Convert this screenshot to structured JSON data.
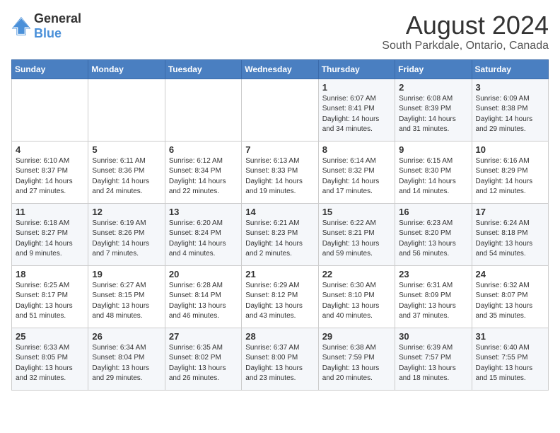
{
  "header": {
    "logo_general": "General",
    "logo_blue": "Blue",
    "month_year": "August 2024",
    "location": "South Parkdale, Ontario, Canada"
  },
  "days_of_week": [
    "Sunday",
    "Monday",
    "Tuesday",
    "Wednesday",
    "Thursday",
    "Friday",
    "Saturday"
  ],
  "weeks": [
    [
      {
        "day": "",
        "text": ""
      },
      {
        "day": "",
        "text": ""
      },
      {
        "day": "",
        "text": ""
      },
      {
        "day": "",
        "text": ""
      },
      {
        "day": "1",
        "text": "Sunrise: 6:07 AM\nSunset: 8:41 PM\nDaylight: 14 hours\nand 34 minutes."
      },
      {
        "day": "2",
        "text": "Sunrise: 6:08 AM\nSunset: 8:39 PM\nDaylight: 14 hours\nand 31 minutes."
      },
      {
        "day": "3",
        "text": "Sunrise: 6:09 AM\nSunset: 8:38 PM\nDaylight: 14 hours\nand 29 minutes."
      }
    ],
    [
      {
        "day": "4",
        "text": "Sunrise: 6:10 AM\nSunset: 8:37 PM\nDaylight: 14 hours\nand 27 minutes."
      },
      {
        "day": "5",
        "text": "Sunrise: 6:11 AM\nSunset: 8:36 PM\nDaylight: 14 hours\nand 24 minutes."
      },
      {
        "day": "6",
        "text": "Sunrise: 6:12 AM\nSunset: 8:34 PM\nDaylight: 14 hours\nand 22 minutes."
      },
      {
        "day": "7",
        "text": "Sunrise: 6:13 AM\nSunset: 8:33 PM\nDaylight: 14 hours\nand 19 minutes."
      },
      {
        "day": "8",
        "text": "Sunrise: 6:14 AM\nSunset: 8:32 PM\nDaylight: 14 hours\nand 17 minutes."
      },
      {
        "day": "9",
        "text": "Sunrise: 6:15 AM\nSunset: 8:30 PM\nDaylight: 14 hours\nand 14 minutes."
      },
      {
        "day": "10",
        "text": "Sunrise: 6:16 AM\nSunset: 8:29 PM\nDaylight: 14 hours\nand 12 minutes."
      }
    ],
    [
      {
        "day": "11",
        "text": "Sunrise: 6:18 AM\nSunset: 8:27 PM\nDaylight: 14 hours\nand 9 minutes."
      },
      {
        "day": "12",
        "text": "Sunrise: 6:19 AM\nSunset: 8:26 PM\nDaylight: 14 hours\nand 7 minutes."
      },
      {
        "day": "13",
        "text": "Sunrise: 6:20 AM\nSunset: 8:24 PM\nDaylight: 14 hours\nand 4 minutes."
      },
      {
        "day": "14",
        "text": "Sunrise: 6:21 AM\nSunset: 8:23 PM\nDaylight: 14 hours\nand 2 minutes."
      },
      {
        "day": "15",
        "text": "Sunrise: 6:22 AM\nSunset: 8:21 PM\nDaylight: 13 hours\nand 59 minutes."
      },
      {
        "day": "16",
        "text": "Sunrise: 6:23 AM\nSunset: 8:20 PM\nDaylight: 13 hours\nand 56 minutes."
      },
      {
        "day": "17",
        "text": "Sunrise: 6:24 AM\nSunset: 8:18 PM\nDaylight: 13 hours\nand 54 minutes."
      }
    ],
    [
      {
        "day": "18",
        "text": "Sunrise: 6:25 AM\nSunset: 8:17 PM\nDaylight: 13 hours\nand 51 minutes."
      },
      {
        "day": "19",
        "text": "Sunrise: 6:27 AM\nSunset: 8:15 PM\nDaylight: 13 hours\nand 48 minutes."
      },
      {
        "day": "20",
        "text": "Sunrise: 6:28 AM\nSunset: 8:14 PM\nDaylight: 13 hours\nand 46 minutes."
      },
      {
        "day": "21",
        "text": "Sunrise: 6:29 AM\nSunset: 8:12 PM\nDaylight: 13 hours\nand 43 minutes."
      },
      {
        "day": "22",
        "text": "Sunrise: 6:30 AM\nSunset: 8:10 PM\nDaylight: 13 hours\nand 40 minutes."
      },
      {
        "day": "23",
        "text": "Sunrise: 6:31 AM\nSunset: 8:09 PM\nDaylight: 13 hours\nand 37 minutes."
      },
      {
        "day": "24",
        "text": "Sunrise: 6:32 AM\nSunset: 8:07 PM\nDaylight: 13 hours\nand 35 minutes."
      }
    ],
    [
      {
        "day": "25",
        "text": "Sunrise: 6:33 AM\nSunset: 8:05 PM\nDaylight: 13 hours\nand 32 minutes."
      },
      {
        "day": "26",
        "text": "Sunrise: 6:34 AM\nSunset: 8:04 PM\nDaylight: 13 hours\nand 29 minutes."
      },
      {
        "day": "27",
        "text": "Sunrise: 6:35 AM\nSunset: 8:02 PM\nDaylight: 13 hours\nand 26 minutes."
      },
      {
        "day": "28",
        "text": "Sunrise: 6:37 AM\nSunset: 8:00 PM\nDaylight: 13 hours\nand 23 minutes."
      },
      {
        "day": "29",
        "text": "Sunrise: 6:38 AM\nSunset: 7:59 PM\nDaylight: 13 hours\nand 20 minutes."
      },
      {
        "day": "30",
        "text": "Sunrise: 6:39 AM\nSunset: 7:57 PM\nDaylight: 13 hours\nand 18 minutes."
      },
      {
        "day": "31",
        "text": "Sunrise: 6:40 AM\nSunset: 7:55 PM\nDaylight: 13 hours\nand 15 minutes."
      }
    ]
  ]
}
